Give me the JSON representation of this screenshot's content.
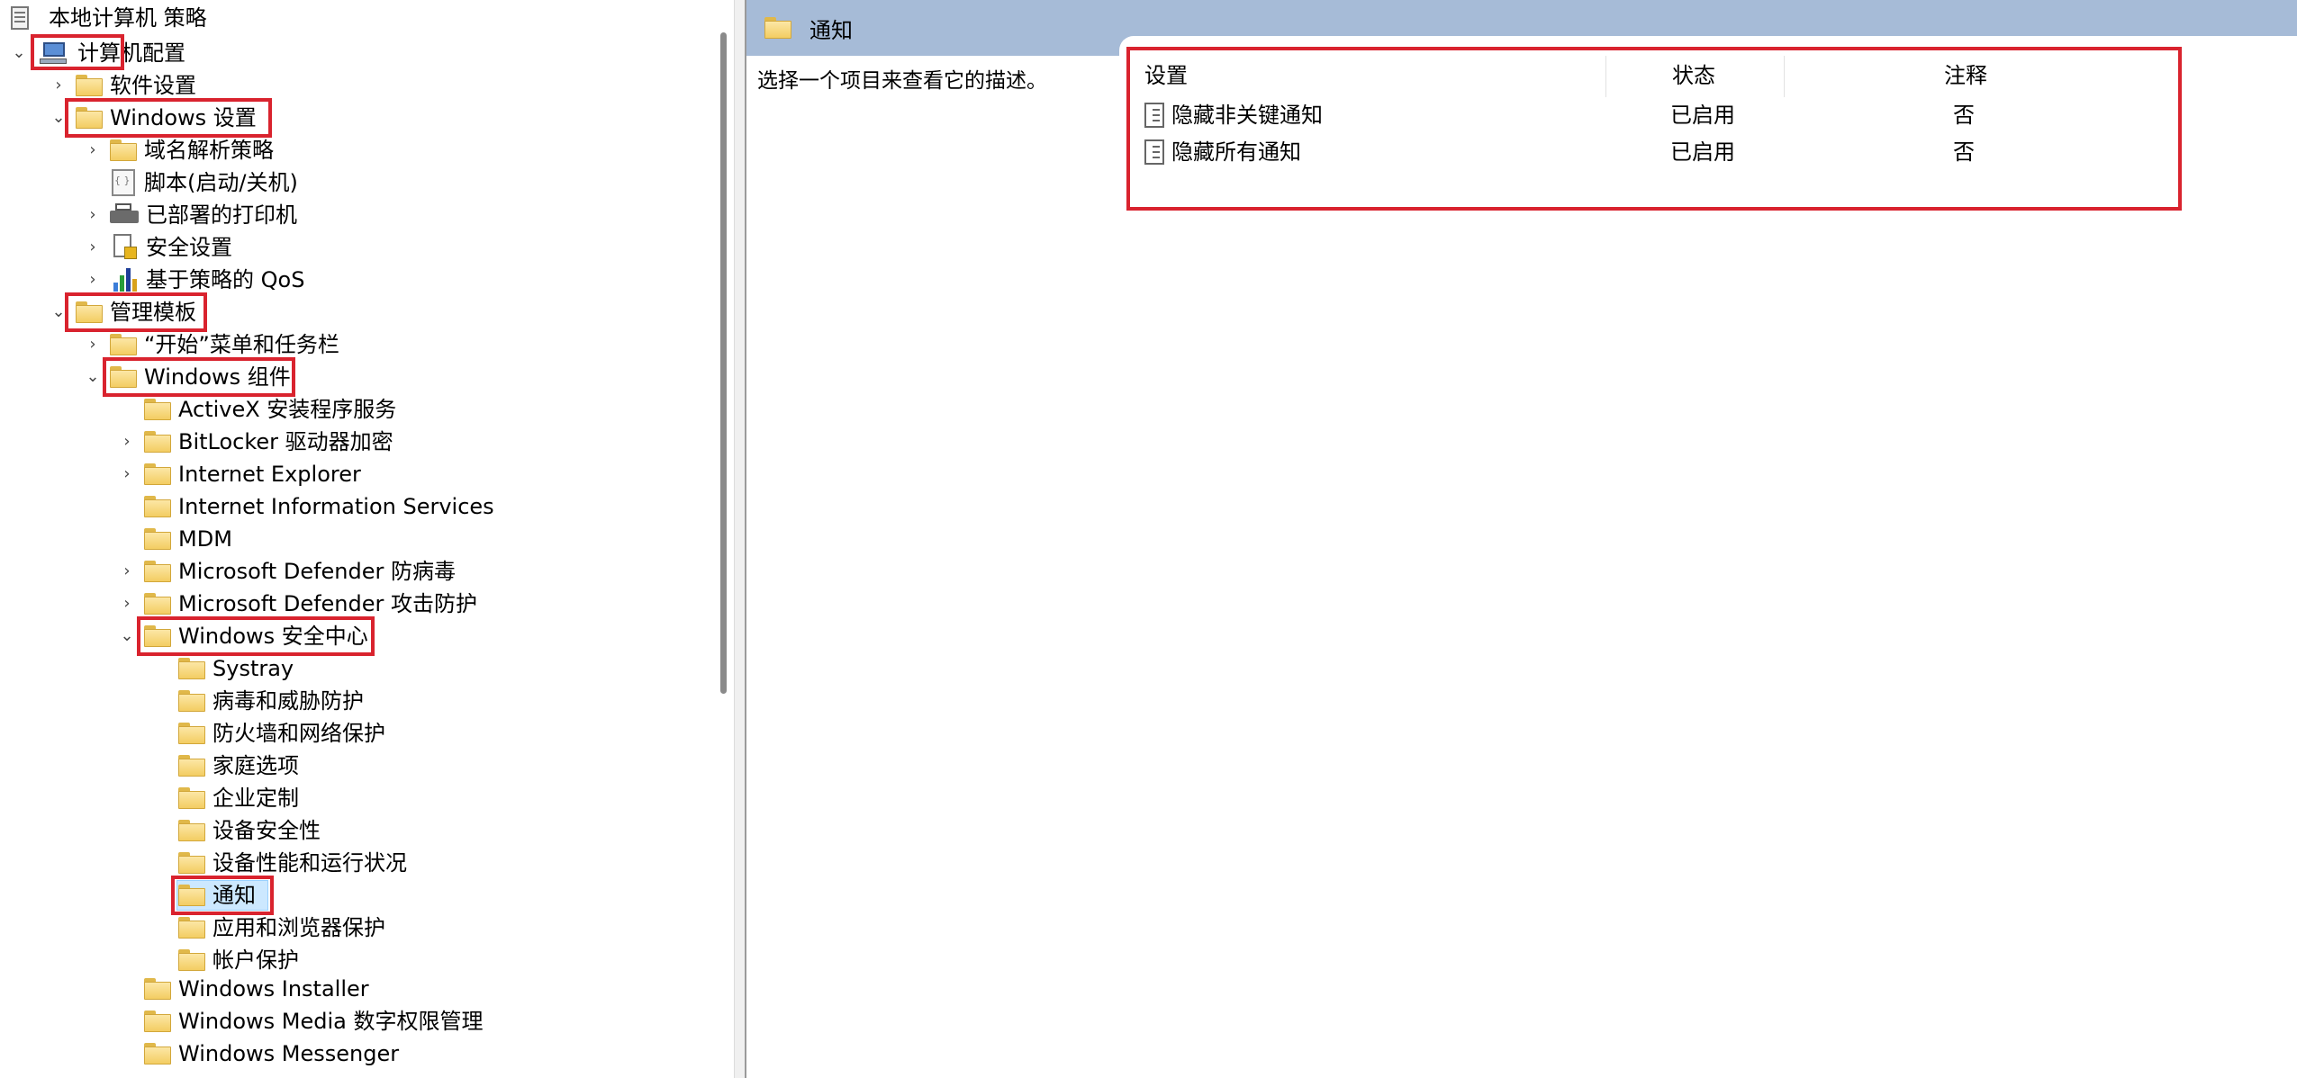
{
  "tree": {
    "root_label": "本地计算机 策略",
    "computer_config": "计算机配置",
    "software_settings": "软件设置",
    "windows_settings": "Windows 设置",
    "name_resolution_policy": "域名解析策略",
    "scripts": "脚本(启动/关机)",
    "deployed_printers": "已部署的打印机",
    "security_settings": "安全设置",
    "qos": "基于策略的 QoS",
    "admin_templates": "管理模板",
    "start_menu_taskbar": "“开始”菜单和任务栏",
    "windows_components": "Windows 组件",
    "activex": "ActiveX 安装程序服务",
    "bitlocker": "BitLocker 驱动器加密",
    "ie": "Internet Explorer",
    "iis": "Internet Information Services",
    "mdm": "MDM",
    "defender_av": "Microsoft Defender 防病毒",
    "defender_attack": "Microsoft Defender 攻击防护",
    "security_center": "Windows 安全中心",
    "systray": "Systray",
    "virus_threat": "病毒和威胁防护",
    "firewall": "防火墙和网络保护",
    "family": "家庭选项",
    "enterprise": "企业定制",
    "device_security": "设备安全性",
    "device_performance": "设备性能和运行状况",
    "notifications": "通知",
    "app_browser": "应用和浏览器保护",
    "account": "帐户保护",
    "installer": "Windows Installer",
    "media_drm": "Windows Media 数字权限管理",
    "messenger": "Windows Messenger"
  },
  "right": {
    "header_title": "通知",
    "description": "选择一个项目来查看它的描述。",
    "columns": {
      "setting": "设置",
      "state": "状态",
      "comment": "注释"
    },
    "rows": [
      {
        "setting": "隐藏非关键通知",
        "state": "已启用",
        "comment": "否"
      },
      {
        "setting": "隐藏所有通知",
        "state": "已启用",
        "comment": "否"
      }
    ]
  },
  "colors": {
    "highlight_box": "#d9232e",
    "header_bg": "#a6bbd7",
    "selection": "#cce8ff"
  }
}
